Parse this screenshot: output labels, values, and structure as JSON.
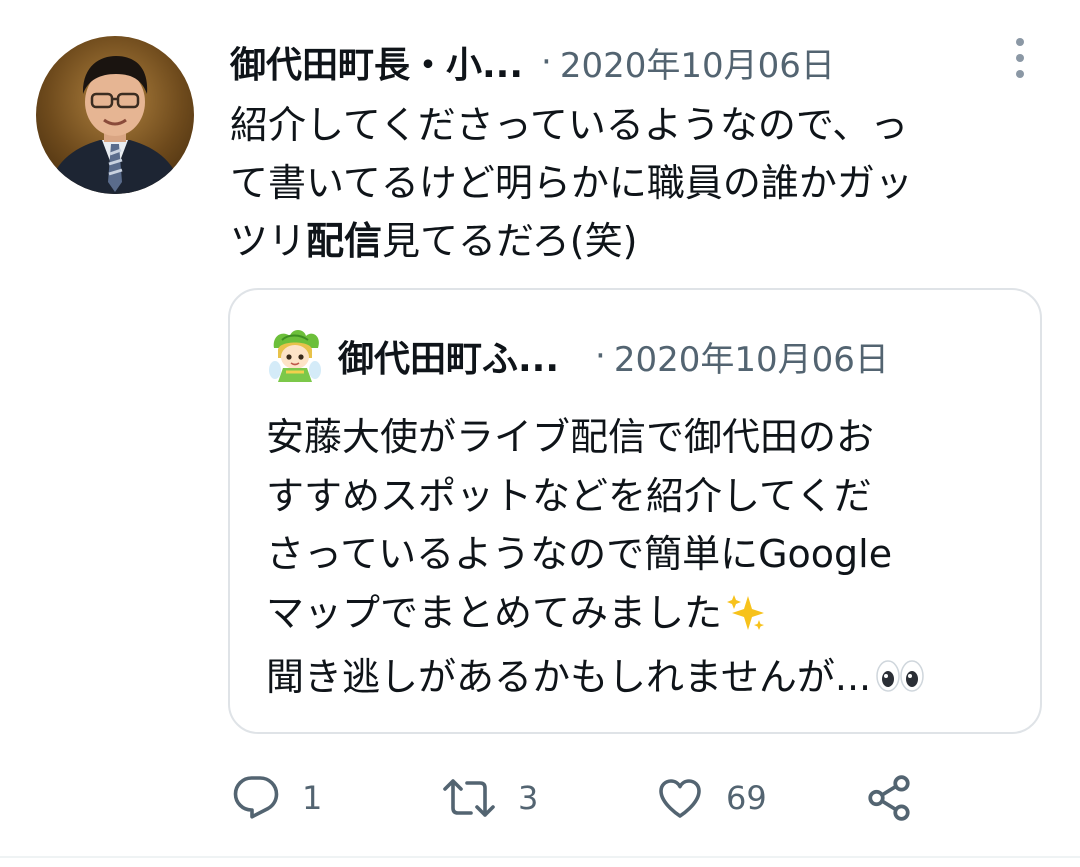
{
  "tweet": {
    "author_name": "御代田町長・小...",
    "separator": "·",
    "timestamp": "2020年10月06日",
    "text_lines": [
      "紹介してくださっているようなので、っ",
      "て書いてるけど明らかに職員の誰かガッ"
    ],
    "text_line3_pre": "ツリ",
    "text_line3_bold": "配信",
    "text_line3_post": "見てるだろ(笑)"
  },
  "quote": {
    "author_name": "御代田町ふ...",
    "separator": "·",
    "timestamp": "2020年10月06日",
    "text_lines": [
      "安藤大使がライブ配信で御代田のお",
      "すすめスポットなどを紹介してくだ",
      "さっているようなので簡単にGoogle",
      "マップでまとめてみました",
      "聞き逃しがあるかもしれませんが..."
    ],
    "line4_emoji": "sparkles-emoji",
    "line5_emoji": "eyes-emoji"
  },
  "actions": {
    "reply_count": "1",
    "retweet_count": "3",
    "like_count": "69"
  },
  "icons": {
    "reply": "reply-icon",
    "retweet": "retweet-icon",
    "like": "heart-icon",
    "share": "share-icon",
    "more": "more-vertical-icon"
  },
  "colors": {
    "text": "#0f1419",
    "muted": "#536471",
    "border": "#dfe3e7",
    "icon": "#536471"
  }
}
